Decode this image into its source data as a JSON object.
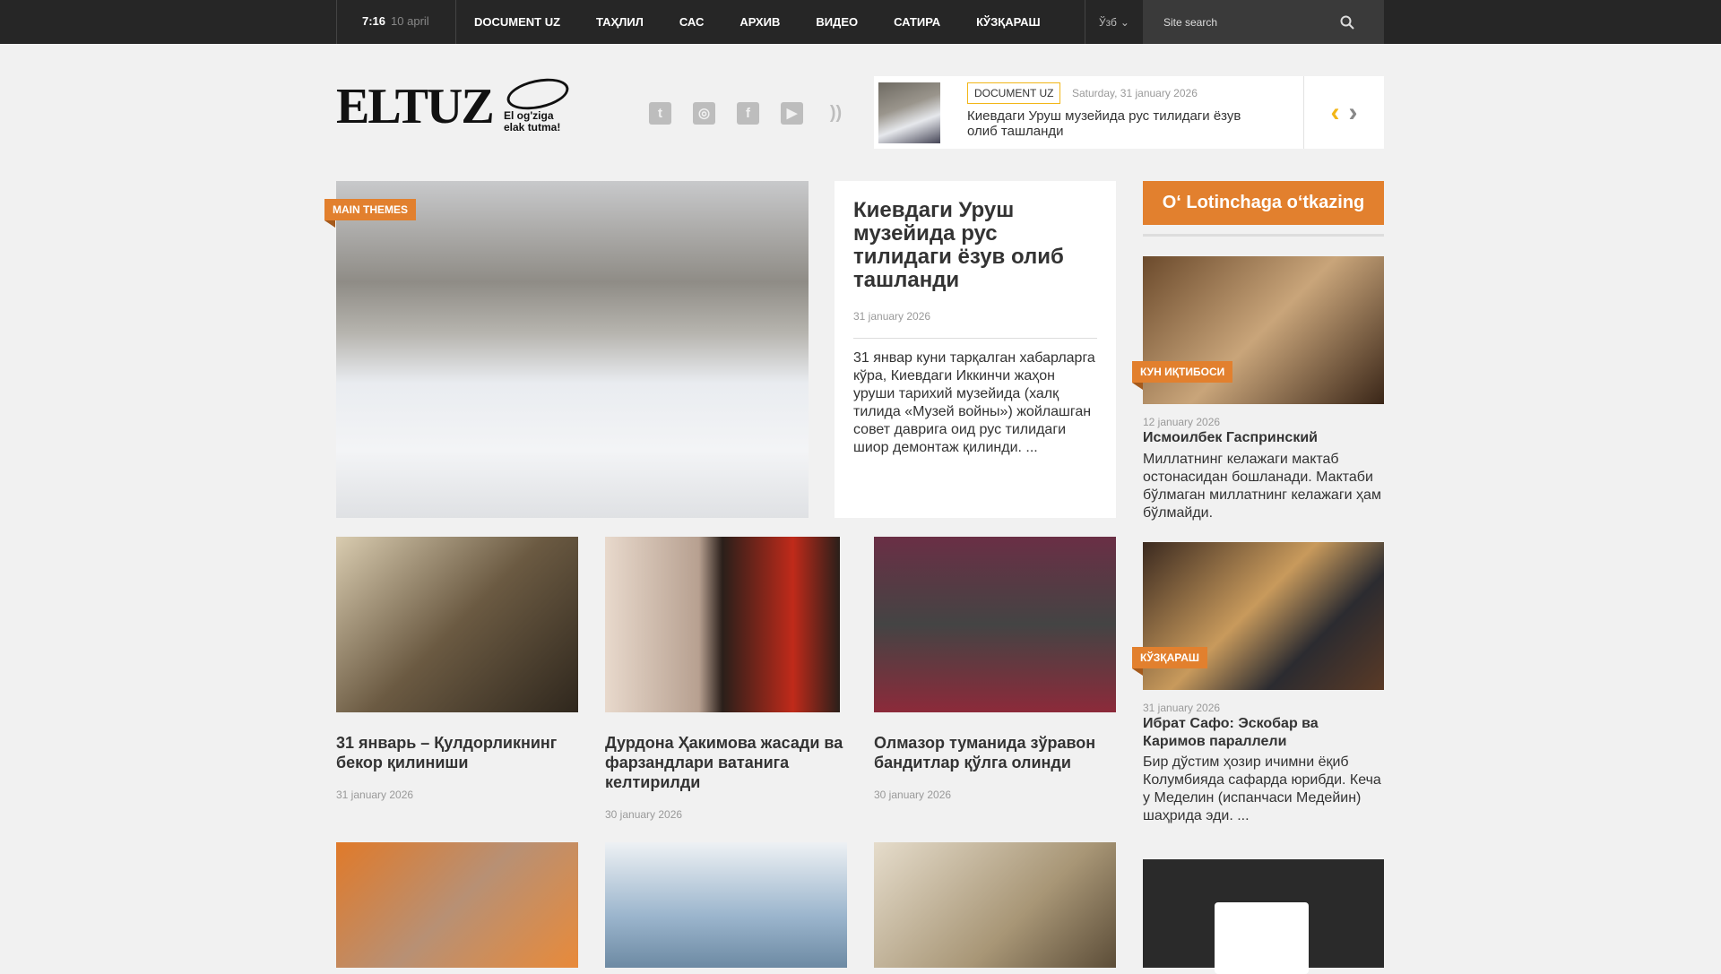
{
  "topbar": {
    "time": "7:16",
    "date": "10 april",
    "nav": [
      "DOCUMENT UZ",
      "ТАҲЛИЛ",
      "САС",
      "АРХИВ",
      "ВИДЕО",
      "САТИРА",
      "КЎЗҚАРАШ"
    ],
    "lang": "Ўзб",
    "search_placeholder": "Site search"
  },
  "logo": {
    "name": "ELTUZ",
    "tagline": "El og'ziga elak tutma!"
  },
  "social": [
    "twitter-icon",
    "instagram-icon",
    "facebook-icon",
    "youtube-icon",
    "rss-icon"
  ],
  "ticker": {
    "category": "DOCUMENT UZ",
    "date": "Saturday, 31 january 2026",
    "title": "Киевдаги Уруш музейида рус тилидаги ёзув олиб ташланди"
  },
  "hero": {
    "tag": "MAIN THEMES",
    "title": "Киевдаги Уруш музейида рус тилидаги ёзув олиб ташланди",
    "date": "31 january 2026",
    "excerpt": "31 январ куни тарқалган хабарларга кўра, Киевдаги Иккинчи жаҳон уруши тарихий музейида (халқ тилида «Музей войны») жойлашган совет даврига оид рус тилидаги шиор демонтаж қилинди. ..."
  },
  "sidebar": {
    "button": "O‘ Lotinchaga o‘tkazing",
    "items": [
      {
        "tag": "КУН ИҚТИБОСИ",
        "date": "12 january 2026",
        "title": "Исмоилбек Гаспринский",
        "excerpt": "Миллатнинг келажаги мактаб остонасидан бошланади. Мактаби бўлмаган миллатнинг келажаги ҳам бўлмайди."
      },
      {
        "tag": "КЎЗҚАРАШ",
        "date": "31 january 2026",
        "title": "Ибрат Сафо:  Эскобар ва Каримов параллели",
        "excerpt": "Бир дўстим ҳозир ичимни ёқиб Колумбияда сафарда юрибди. Кеча у Меделин (испанчаси Медейин) шаҳрида эди. ..."
      }
    ]
  },
  "cards": [
    {
      "title": "31 январь – Қулдорликнинг бекор қилиниши",
      "date": "31 january 2026"
    },
    {
      "title": "Дурдона Ҳакимова жасади ва фарзандлари ватанига келтирилди",
      "date": "30 january 2026"
    },
    {
      "title": "Олмазор туманида зўравон бандитлар қўлга олинди",
      "date": "30 january 2026"
    }
  ],
  "colors": {
    "accent": "#e2802e",
    "topbar": "#262626",
    "ticker_border": "#f2b618"
  }
}
